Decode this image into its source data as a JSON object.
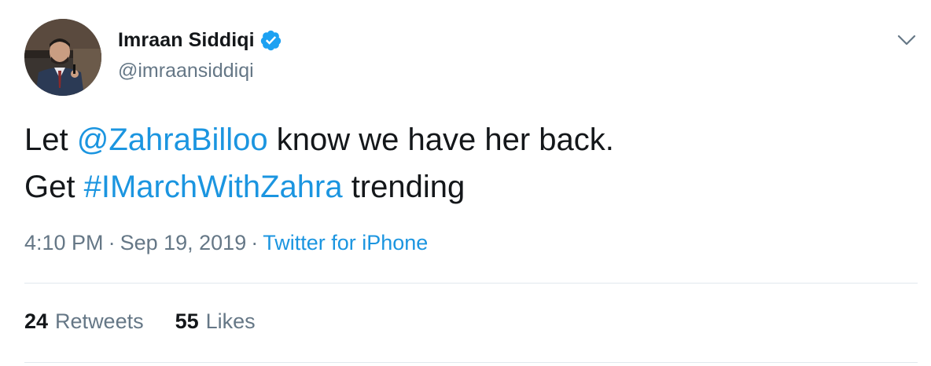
{
  "author": {
    "display_name": "Imraan Siddiqi",
    "handle": "@imraansiddiqi",
    "verified": true,
    "avatar_alt": "Imraan Siddiqi"
  },
  "tweet": {
    "line1": {
      "before": "Let ",
      "mention": "@ZahraBilloo",
      "after": " know we have her back."
    },
    "line2": {
      "before": "Get ",
      "hashtag": "#IMarchWithZahra",
      "after": " trending"
    }
  },
  "meta": {
    "time": "4:10 PM",
    "separator": "·",
    "date": "Sep 19, 2019",
    "source": "Twitter for iPhone"
  },
  "stats": {
    "retweets_count": "24",
    "retweets_label": "Retweets",
    "likes_count": "55",
    "likes_label": "Likes"
  },
  "icons": {
    "verified": "verified-badge-icon",
    "caret": "chevron-down-icon"
  },
  "colors": {
    "link": "#1b95e0",
    "text": "#14171a",
    "muted": "#657786",
    "divider": "#e1e8ed",
    "verified": "#1da1f2"
  }
}
